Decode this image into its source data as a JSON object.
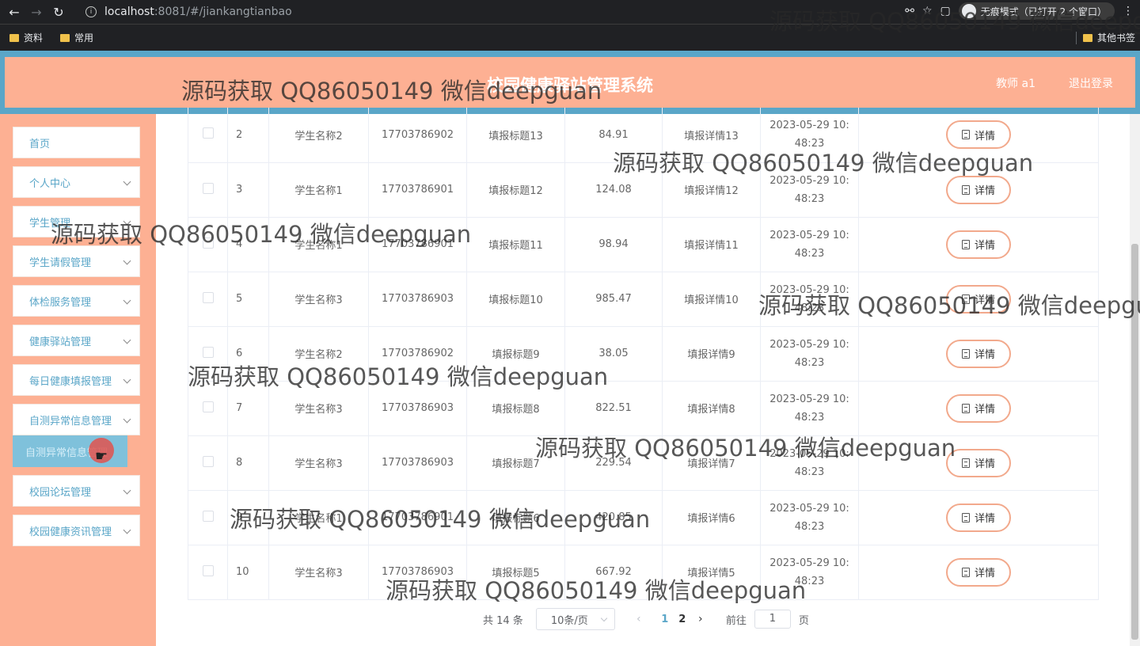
{
  "browser": {
    "url_host": "localhost",
    "url_path": ":8081/#/jiankangtianbao",
    "incognito_label": "无痕模式（已打开 2 个窗口）",
    "bookmarks": [
      "资料",
      "常用"
    ],
    "other_bookmarks": "其他书签"
  },
  "header": {
    "title": "校园健康驿站管理系统",
    "user": "教师 a1",
    "logout": "退出登录"
  },
  "sidebar": {
    "items": [
      {
        "label": "首页",
        "has_arrow": false
      },
      {
        "label": "个人中心",
        "has_arrow": true
      },
      {
        "label": "学生管理",
        "has_arrow": true
      },
      {
        "label": "学生请假管理",
        "has_arrow": true
      },
      {
        "label": "体检服务管理",
        "has_arrow": true
      },
      {
        "label": "健康驿站管理",
        "has_arrow": true
      },
      {
        "label": "每日健康填报管理",
        "has_arrow": true
      },
      {
        "label": "自测异常信息管理",
        "has_arrow": true
      },
      {
        "label": "校园论坛管理",
        "has_arrow": true
      },
      {
        "label": "校园健康资讯管理",
        "has_arrow": true
      }
    ],
    "active_submenu": "自测异常信息管理"
  },
  "table": {
    "detail_label": "详情",
    "rows": [
      {
        "index": "2",
        "name": "学生名称2",
        "phone": "17703786902",
        "title": "填报标题13",
        "value": "84.91",
        "detail": "填报详情13",
        "time_date": "2023-05-29 10:",
        "time_clock": "48:23"
      },
      {
        "index": "3",
        "name": "学生名称1",
        "phone": "17703786901",
        "title": "填报标题12",
        "value": "124.08",
        "detail": "填报详情12",
        "time_date": "2023-05-29 10:",
        "time_clock": "48:23"
      },
      {
        "index": "4",
        "name": "学生名称1",
        "phone": "17703786901",
        "title": "填报标题11",
        "value": "98.94",
        "detail": "填报详情11",
        "time_date": "2023-05-29 10:",
        "time_clock": "48:23"
      },
      {
        "index": "5",
        "name": "学生名称3",
        "phone": "17703786903",
        "title": "填报标题10",
        "value": "985.47",
        "detail": "填报详情10",
        "time_date": "2023-05-29 10:",
        "time_clock": "48:23"
      },
      {
        "index": "6",
        "name": "学生名称2",
        "phone": "17703786902",
        "title": "填报标题9",
        "value": "38.05",
        "detail": "填报详情9",
        "time_date": "2023-05-29 10:",
        "time_clock": "48:23"
      },
      {
        "index": "7",
        "name": "学生名称3",
        "phone": "17703786903",
        "title": "填报标题8",
        "value": "822.51",
        "detail": "填报详情8",
        "time_date": "2023-05-29 10:",
        "time_clock": "48:23"
      },
      {
        "index": "8",
        "name": "学生名称3",
        "phone": "17703786903",
        "title": "填报标题7",
        "value": "229.54",
        "detail": "填报详情7",
        "time_date": "2023-05-29 10:",
        "time_clock": "48:23"
      },
      {
        "index": "9",
        "name": "学生名称1",
        "phone": "17703786901",
        "title": "填报标题6",
        "value": "420.85",
        "detail": "填报详情6",
        "time_date": "2023-05-29 10:",
        "time_clock": "48:23"
      },
      {
        "index": "10",
        "name": "学生名称3",
        "phone": "17703786903",
        "title": "填报标题5",
        "value": "667.92",
        "detail": "填报详情5",
        "time_date": "2023-05-29 10:",
        "time_clock": "48:23"
      }
    ]
  },
  "pagination": {
    "total": "共 14 条",
    "page_size": "10条/页",
    "pages": [
      "1",
      "2"
    ],
    "current_page": "1",
    "goto_prefix": "前往",
    "goto_value": "1",
    "goto_suffix": "页"
  },
  "watermark": "源码获取 QQ86050149 微信deepguan",
  "colors": {
    "header_bg": "#fdb093",
    "frame_blue": "#5aa6c8",
    "menu_text": "#5aa6c8",
    "button_border": "#f2a98c"
  }
}
